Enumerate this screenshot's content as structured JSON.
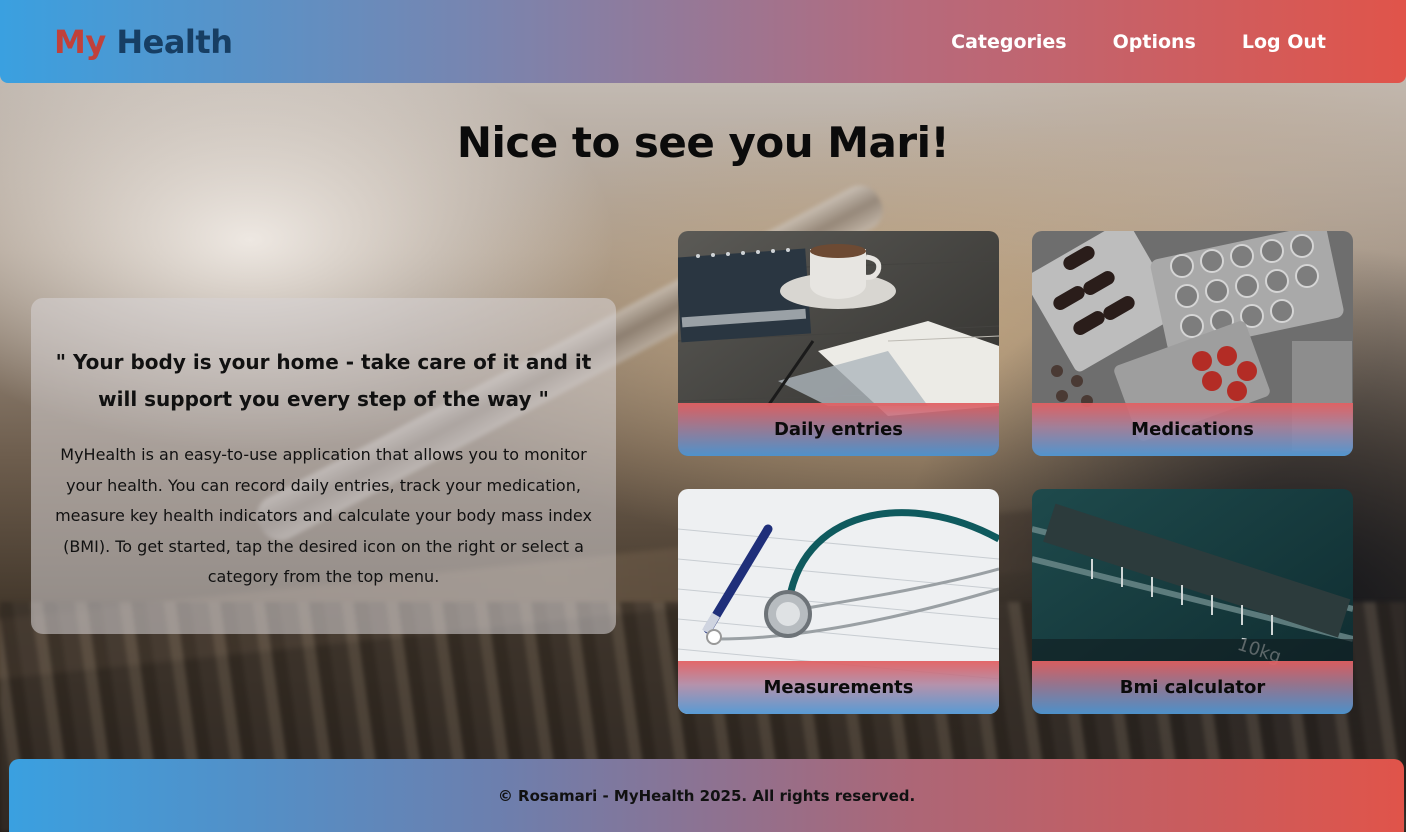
{
  "header": {
    "logo_part1": "My",
    "logo_part2": "Health",
    "nav": [
      {
        "label": "Categories"
      },
      {
        "label": "Options"
      },
      {
        "label": "Log Out"
      }
    ]
  },
  "main": {
    "greeting": "Nice to see you Mari!",
    "quote": "\" Your body is your home - take care of it and it will support you every step of the way \"",
    "description": "MyHealth is an easy-to-use application that allows you to monitor your health. You can record daily entries, track your medication, measure key health indicators and calculate your body mass index (BMI). To get started, tap the desired icon on the right or select a category from the top menu.",
    "tiles": [
      {
        "label": "Daily entries",
        "image": "notebook-coffee-photo"
      },
      {
        "label": "Medications",
        "image": "pill-blister-photo"
      },
      {
        "label": "Measurements",
        "image": "stethoscope-pen-photo"
      },
      {
        "label": "Bmi calculator",
        "image": "weighing-scale-photo"
      }
    ]
  },
  "footer": {
    "text": "© Rosamari - MyHealth 2025. All rights reserved."
  },
  "colors": {
    "header_gradient_start": "#3aa0e0",
    "header_gradient_end": "#e0544a",
    "logo_my": "#c0413b",
    "logo_health": "#173e63"
  }
}
